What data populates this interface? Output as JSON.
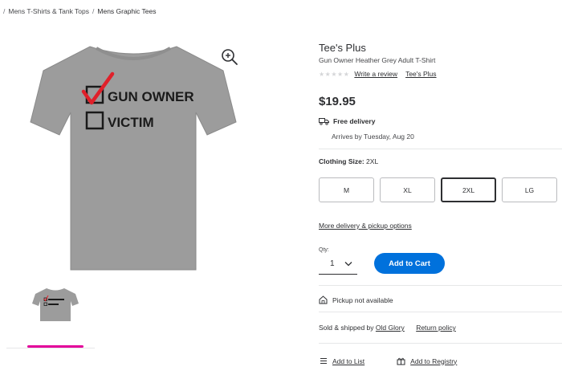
{
  "breadcrumb": {
    "items": [
      "Mens T-Shirts & Tank Tops",
      "Mens Graphic Tees"
    ],
    "separator": "/"
  },
  "product": {
    "brand": "Tee's Plus",
    "title": "Gun Owner Heather Grey Adult T-Shirt",
    "write_review": "Write a review",
    "brand_link": "Tee's Plus",
    "price": "$19.95",
    "image_text_line1": "GUN OWNER",
    "image_text_line2": "VICTIM",
    "shirt_color": "#9c9c9c"
  },
  "delivery": {
    "label": "Free delivery",
    "arrives": "Arrives by Tuesday, Aug 20"
  },
  "size": {
    "label": "Clothing Size:",
    "selected": "2XL",
    "options": [
      "M",
      "XL",
      "2XL",
      "LG"
    ]
  },
  "more_options": "More delivery & pickup options",
  "quantity": {
    "label": "Qty:",
    "value": "1"
  },
  "add_to_cart": "Add to Cart",
  "pickup": "Pickup not available",
  "seller": {
    "prefix": "Sold & shipped by",
    "name": "Old Glory",
    "return_policy": "Return policy"
  },
  "actions": {
    "add_to_list": "Add to List",
    "add_to_registry": "Add to Registry"
  },
  "colors": {
    "primary_button": "#0071dc",
    "thumb_indicator": "#e3009a",
    "check_mark": "#e0202a"
  }
}
